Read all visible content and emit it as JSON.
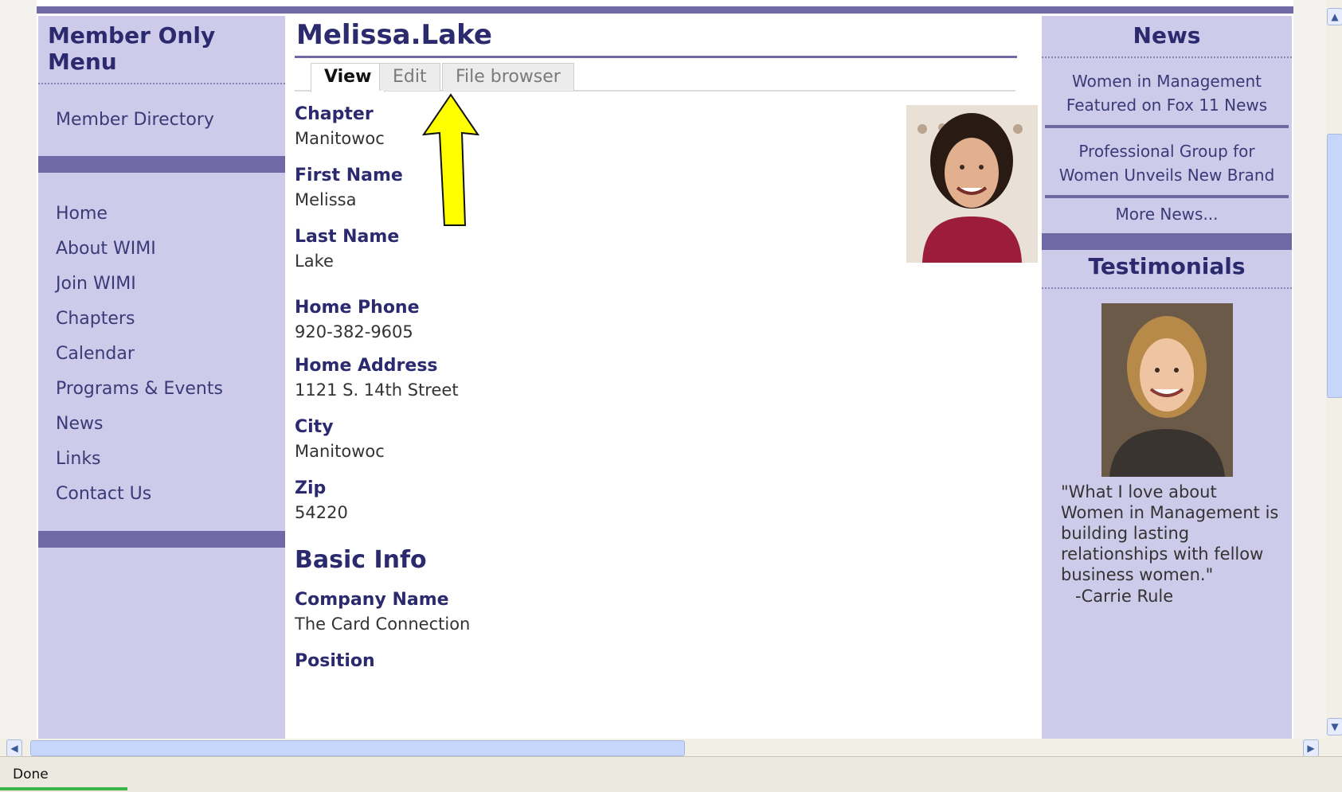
{
  "sidebar": {
    "title": "Member Only Menu",
    "member_directory": "Member Directory",
    "nav": [
      "Home",
      "About WIMI",
      "Join WIMI",
      "Chapters",
      "Calendar",
      "Programs & Events",
      "News",
      "Links",
      "Contact Us"
    ]
  },
  "main": {
    "title": "Melissa.Lake",
    "tabs": [
      "View",
      "Edit",
      "File browser"
    ],
    "active_tab": "View",
    "fields": [
      {
        "label": "Chapter",
        "value": "Manitowoc"
      },
      {
        "label": "First Name",
        "value": "Melissa"
      },
      {
        "label": "Last Name",
        "value": "Lake"
      },
      {
        "label": "Home Phone",
        "value": "920-382-9605"
      },
      {
        "label": "Home Address",
        "value": "1121 S. 14th Street"
      },
      {
        "label": "City",
        "value": "Manitowoc"
      },
      {
        "label": "Zip",
        "value": "54220"
      }
    ],
    "section_heading": "Basic Info",
    "basic_fields": [
      {
        "label": "Company Name",
        "value": "The Card Connection"
      },
      {
        "label": "Position",
        "value": ""
      }
    ],
    "annotation_arrow_color": "#ffff00"
  },
  "right": {
    "news_title": "News",
    "news_items": [
      "Women in Management Featured on Fox 11 News",
      "Professional Group for Women Unveils New Brand"
    ],
    "more_news": "More News...",
    "testimonials_title": "Testimonials",
    "quote": "\"What I love about Women in Management is building lasting relationships with fellow business women.\"",
    "author": "-Carrie Rule"
  },
  "status": {
    "text": "Done"
  },
  "colors": {
    "accent": "#6f6aa6",
    "sidebar_bg": "#cdcbe9",
    "heading": "#2c2a6e"
  }
}
